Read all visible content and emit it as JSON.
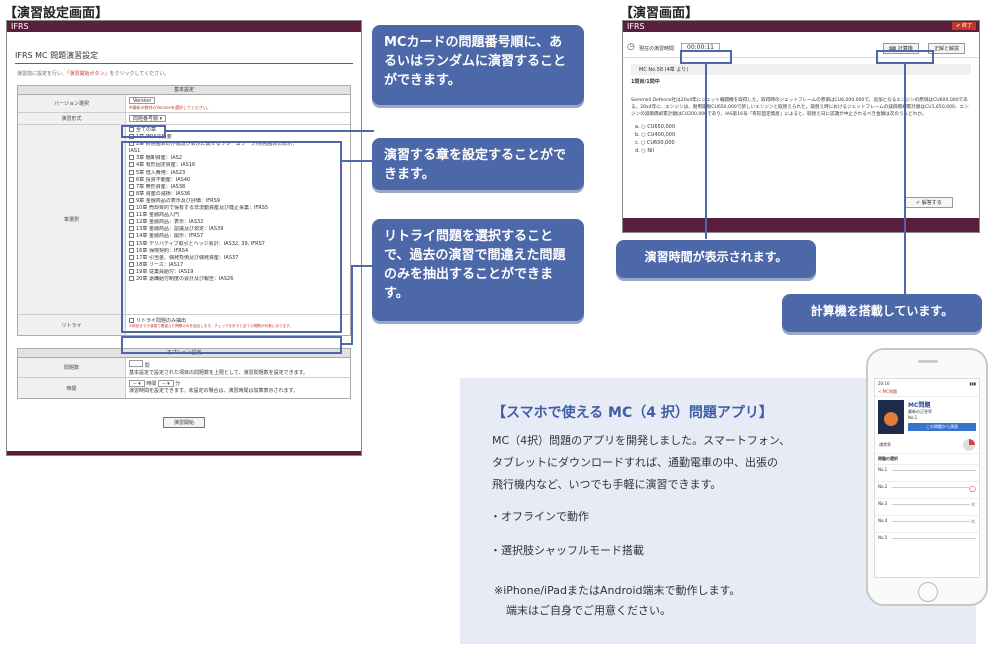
{
  "left": {
    "heading": "【演習設定画面】",
    "app_title": "IFRS",
    "panel_title": "IFRS MC 問題演習設定",
    "intro_note_plain": "演習前に設定を行い、",
    "intro_note_link": "「演習開始ボタン」",
    "intro_note_end": "をクリックしてください。",
    "basic_header": "基本設定",
    "version_label": "バージョン選択",
    "version_value": "Version",
    "version_note": "※最新の教材のVersionを選択してください。",
    "mode_label": "演習形式",
    "mode_value": "問題番号順",
    "chapter_label": "章選択",
    "chapters": [
      "全ての章",
      "1章 IFRSの概要",
      "2章 財務諸表の作成及び表示に関するフレームワーク/財務諸表の表示：",
      "IAS1",
      "3章 棚卸資産：IAS2",
      "4章 有形固定資産：IAS16",
      "5章 借入費用：IAS23",
      "6章 投資不動産：IAS40",
      "7章 無形資産：IAS38",
      "8章 資産の減損：IAS36",
      "9章 金融商品の表示及び評価：IFRS9",
      "10章 売却目的で保有する非流動資産及び廃止事業：IFRS5",
      "11章 金融商品入門",
      "12章 金融商品：表示：IAS32",
      "13章 金融商品：認識及び測定：IAS39",
      "14章 金融商品：開示：IFRS7",
      "15章 デリバティブ取引とヘッジ会計：IAS32, 39, IFRS7",
      "16章 保険契約：IFRS4",
      "17章 引当金、偶発負債及び偶発資産：IAS37",
      "18章 リース：IAS17",
      "19章 従業員給付：IAS19",
      "20章 退職給付制度の会計及び報告：IAS26"
    ],
    "retry_label": "リトライ",
    "retry_option": "リトライ問題のみ抽出",
    "retry_note": "※前回までの演習で間違えた問題のみを抽出します。チェックを外すと全ての問題が対象になります。",
    "option_header": "オプション設定",
    "count_label": "問題数",
    "count_unit": "問",
    "count_note": "基本設定で設定された項目の問題数を上限として、演習問題数を設定できます。",
    "time_label": "時間",
    "time_sel1": "--",
    "time_unit1": "時間",
    "time_sel2": "--",
    "time_unit2": "分",
    "time_note": "演習時間を設定できます。未設定の場合は、演習時間は加算表示されます。",
    "start_button": "演習開始"
  },
  "callouts": {
    "c1": "MCカードの問題番号順に、あるいはランダムに演習することができます。",
    "c2": "演習する章を設定することができます。",
    "c3": "リトライ問題を選択することで、過去の演習で間違えた問題のみを抽出することができます。",
    "c4": "演習時間が表示されます。",
    "c5": "計算機を搭載しています。"
  },
  "right": {
    "heading": "【演習画面】",
    "app_title": "IFRS",
    "end_button": "終了",
    "timer_label": "現在の演習時間",
    "timer_value": "00:00:11",
    "calc_button": "計算機",
    "answer_button": "正解と解説",
    "question_id": "MC No.58 (4章 より)",
    "question_progress": "1問目/1問中",
    "question_text": "Sommell Defence社は20x4年にジェット戦闘機を取得した。取得時のジェットフレームの原価はCU6,000,000で、追加となるエンジンの原価はCU600,000である。20x4年に、エンジンは、耐用期限CU650,000で新しいエンジンと取替えられた。取替え時におけるジェットフレームの減価償却累計額はCU1,650,000、エンジンの減価償却累計額はCU200,000であり、IAS第16号「有形固定資産」によると、取替え日に認識が中止されるべき金額は次のうちどれか。",
    "choices": [
      {
        "label": "a.",
        "value": "CU650,000"
      },
      {
        "label": "b.",
        "value": "CU400,000"
      },
      {
        "label": "c.",
        "value": "CU600,000"
      },
      {
        "label": "d.",
        "value": "Nil"
      }
    ],
    "answer_submit": "解答する"
  },
  "promo": {
    "title": "【スマホで使える MC（4 択）問題アプリ】",
    "line1": "MC（4択）問題のアプリを開発しました。スマートフォン、",
    "line2": "タブレットにダウンロードすれば、通勤電車の中、出張の",
    "line3": "飛行機内など、いつでも手軽に演習できます。",
    "bullet1": "・オフラインで動作",
    "bullet2": "・選択肢シャッフルモード搭載",
    "note1": "※iPhone/iPadまたはAndroid端末で動作します。",
    "note2": "端末はご自身でご用意ください。"
  },
  "phone": {
    "time": "20:16",
    "back": "< MC問題",
    "app_name": "MC問題",
    "sub1": "最新の正答率",
    "sub2": "No.1",
    "btn_start": "この問題から演習",
    "score_label": "通常率",
    "section": "問題の選択",
    "rows": [
      "No.1",
      "No.2",
      "No.3",
      "No.4",
      "No.5"
    ]
  },
  "colors": {
    "accent": "#4d68a8",
    "brand_bar": "#5a1f3c",
    "promo_bg": "#e6ebf5"
  }
}
